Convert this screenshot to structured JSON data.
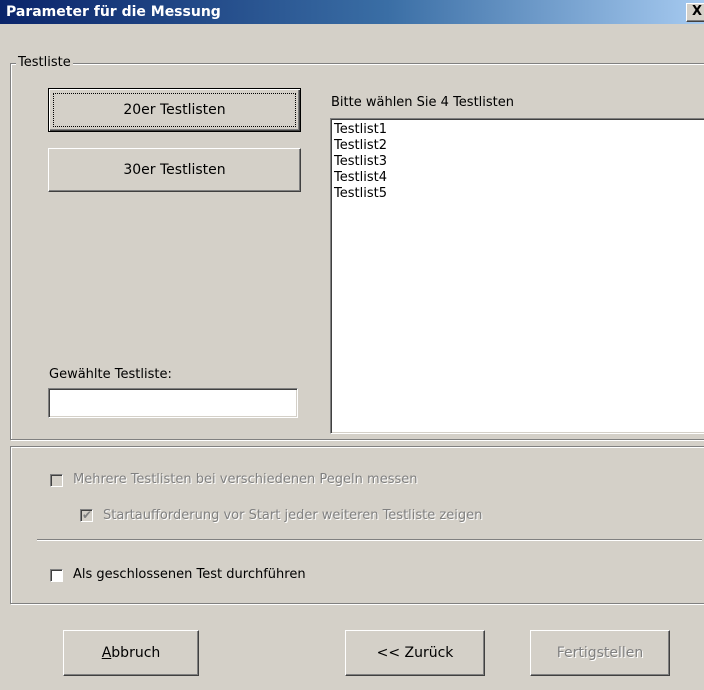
{
  "window": {
    "title": "Parameter für die Messung",
    "close_symbol": "X"
  },
  "testliste_group": {
    "legend": "Testliste",
    "button_20": "20er Testlisten",
    "button_30": "30er Testlisten",
    "list_label": "Bitte wählen Sie 4 Testlisten",
    "list_items": [
      "Testlist1",
      "Testlist2",
      "Testlist3",
      "Testlist4",
      "Testlist5"
    ],
    "selected_label": "Gewählte Testliste:",
    "selected_value": ""
  },
  "options_group": {
    "multi_levels": {
      "label": "Mehrere Testlisten bei verschiedenen Pegeln messen",
      "checked": false,
      "enabled": false
    },
    "start_prompt": {
      "label": "Startaufforderung vor Start jeder weiteren Testliste zeigen",
      "checked": true,
      "enabled": false
    },
    "closed_test": {
      "label": "Als geschlossenen Test durchführen",
      "checked": false,
      "enabled": true
    }
  },
  "footer": {
    "cancel_accel": "A",
    "cancel_rest": "bbruch",
    "back": "<< Zurück",
    "finish": "Fertigstellen"
  }
}
